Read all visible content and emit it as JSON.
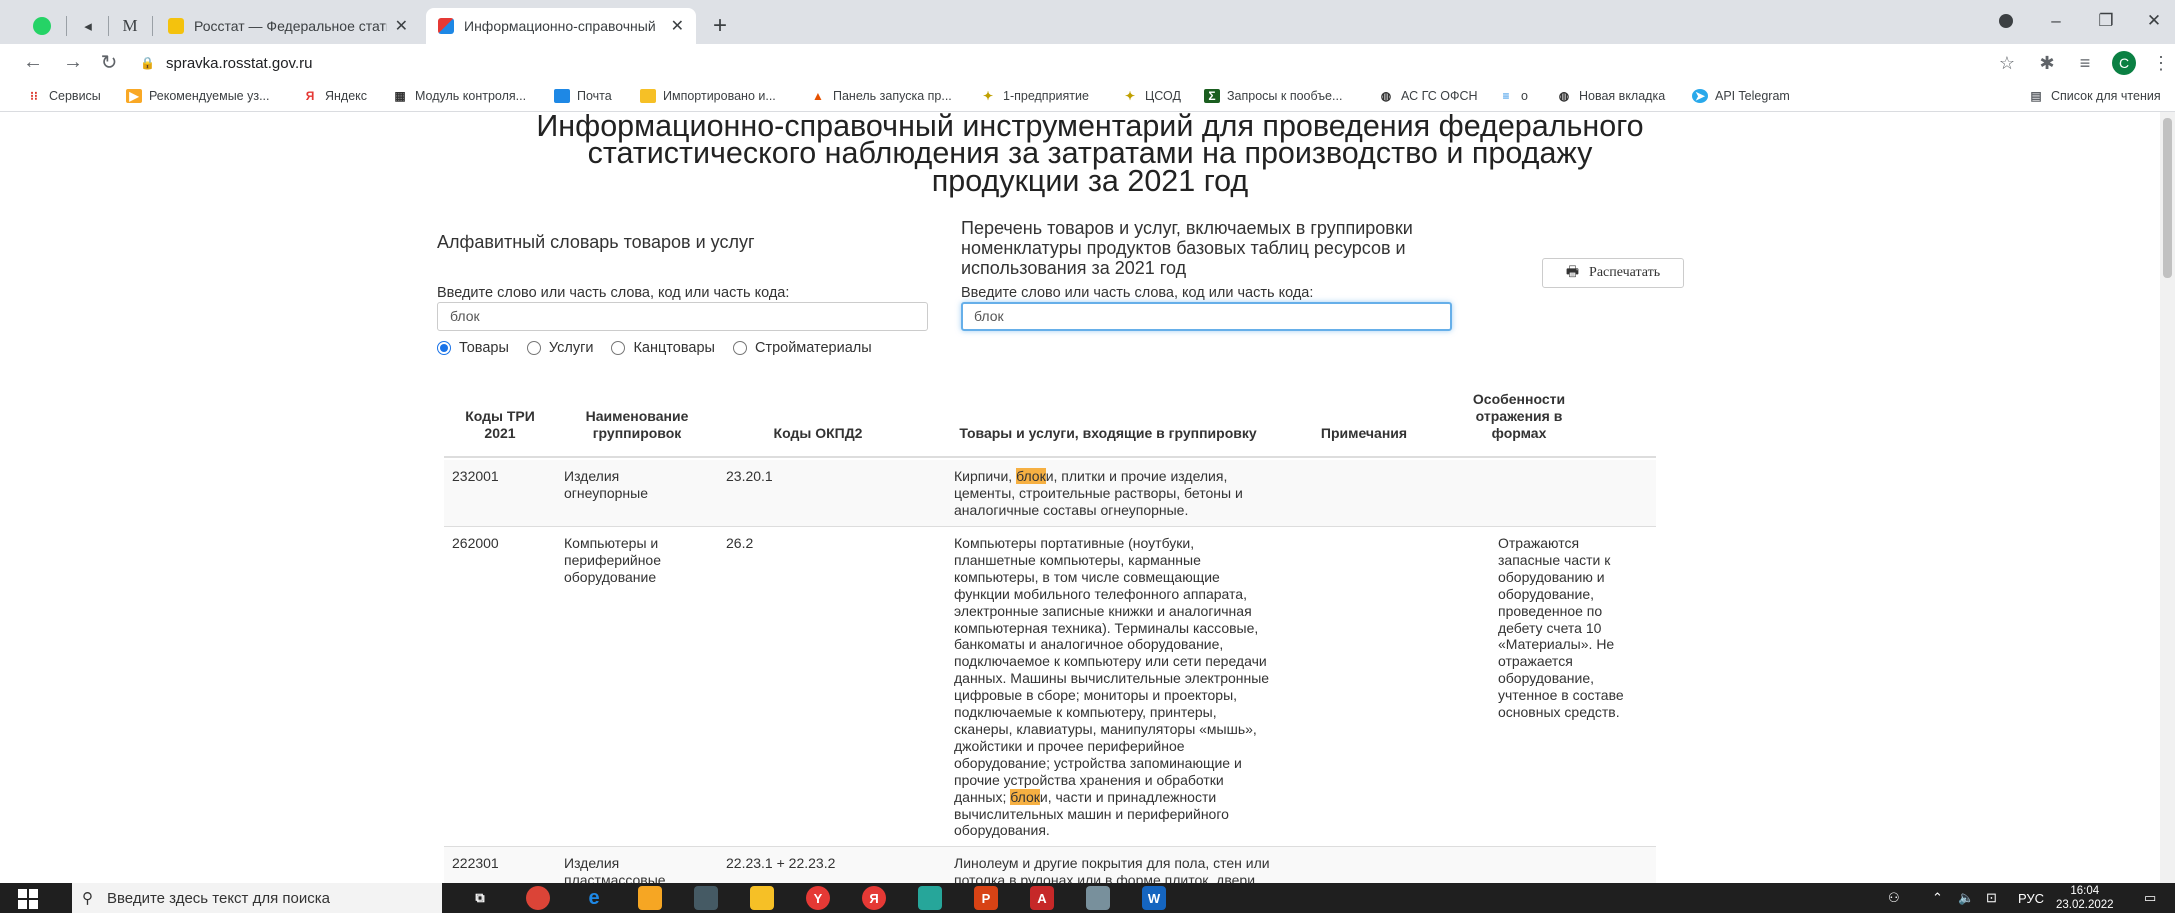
{
  "browser": {
    "tabs": [
      {
        "title": "Росстат — Федеральное статис",
        "active": false
      },
      {
        "title": "Информационно-справочный",
        "active": true
      }
    ],
    "pinned_tab_label": "M",
    "url": "spravka.rosstat.gov.ru",
    "bookmarks": [
      "Сервисы",
      "Рекомендуемые уз...",
      "Яндекс",
      "Модуль контроля...",
      "Почта",
      "Импортировано и...",
      "Панель запуска пр...",
      "1-предприятие",
      "ЦСОД",
      "Запросы к пообъе...",
      "АС ГС ОФСН",
      "о",
      "Новая вкладка",
      "API Telegram"
    ],
    "reading_list": "Список для чтения",
    "profile_initial": "C"
  },
  "page": {
    "title_lines": [
      "Информационно-справочный инструментарий для проведения федерального",
      "статистического наблюдения за затратами на производство и продажу",
      "продукции за 2021 год"
    ],
    "left_section": {
      "title": "Алфавитный словарь товаров и услуг",
      "label": "Введите слово или часть слова, код или часть кода:",
      "value": "блок"
    },
    "right_section": {
      "title_lines": [
        "Перечень товаров и услуг, включаемых в группировки",
        "номенклатуры продуктов базовых таблиц ресурсов и",
        "использования за 2021 год"
      ],
      "label": "Введите слово или часть слова, код или часть кода:",
      "value": "блок"
    },
    "print_button": "Распечатать",
    "radios": [
      {
        "label": "Товары",
        "checked": true
      },
      {
        "label": "Услуги",
        "checked": false
      },
      {
        "label": "Канцтовары",
        "checked": false
      },
      {
        "label": "Стройматериалы",
        "checked": false
      }
    ],
    "table": {
      "headers": {
        "code_tri_1": "Коды ТРИ",
        "code_tri_2": "2021",
        "name_1": "Наименование",
        "name_2": "группировок",
        "okpd": "Коды ОКПД2",
        "goods": "Товары и услуги, входящие в группировку",
        "notes": "Примечания",
        "features_1": "Особенности",
        "features_2": "отражения в",
        "features_3": "формах"
      },
      "rows": [
        {
          "code": "232001",
          "name_lines": [
            "Изделия",
            "огнеупорные"
          ],
          "okpd": "23.20.1",
          "goods_lines": [
            [
              "Кирпичи, ",
              "блок",
              "и, плитки и прочие изделия,"
            ],
            [
              "цементы, строительные растворы, бетоны и"
            ],
            [
              "аналогичные составы огнеупорные."
            ]
          ],
          "features_lines": []
        },
        {
          "code": "262000",
          "name_lines": [
            "Компьютеры и",
            "периферийное",
            "оборудование"
          ],
          "okpd": "26.2",
          "goods_lines": [
            [
              "Компьютеры портативные (ноутбуки,"
            ],
            [
              "планшетные компьютеры, карманные"
            ],
            [
              "компьютеры, в том числе совмещающие"
            ],
            [
              "функции мобильного телефонного аппарата,"
            ],
            [
              "электронные записные книжки и аналогичная"
            ],
            [
              "компьютерная техника). Терминалы кассовые,"
            ],
            [
              "банкоматы и аналогичное оборудование,"
            ],
            [
              "подключаемое к компьютеру или сети передачи"
            ],
            [
              "данных. Машины вычислительные электронные"
            ],
            [
              "цифровые в сборе; мониторы и проекторы,"
            ],
            [
              "подключаемые к компьютеру, принтеры,"
            ],
            [
              "сканеры, клавиатуры, манипуляторы «мышь»,"
            ],
            [
              "джойстики и прочее периферийное"
            ],
            [
              "оборудование; устройства запоминающие и"
            ],
            [
              "прочие устройства хранения и обработки"
            ],
            [
              "данных; ",
              "блок",
              "и, части и принадлежности"
            ],
            [
              "вычислительных машин и периферийного"
            ],
            [
              "оборудования."
            ]
          ],
          "features_lines": [
            "Отражаются",
            "запасные части к",
            "оборудованию и",
            "оборудование,",
            "проведенное по",
            "дебету счета 10",
            "«Материалы». Не",
            "отражается",
            "оборудование,",
            "учтенное в составе",
            "основных средств."
          ]
        },
        {
          "code": "222301",
          "name_lines": [
            "Изделия",
            "пластмассовые"
          ],
          "okpd": "22.23.1 + 22.23.2",
          "goods_lines": [
            [
              "Линолеум и другие покрытия для пола, стен или"
            ],
            [
              "потолка в рулонах или в форме плиток, двери,"
            ]
          ],
          "features_lines": []
        }
      ]
    }
  },
  "taskbar": {
    "search_placeholder": "Введите здесь текст для поиска",
    "language": "РУС",
    "time": "16:04",
    "date": "23.02.2022"
  }
}
